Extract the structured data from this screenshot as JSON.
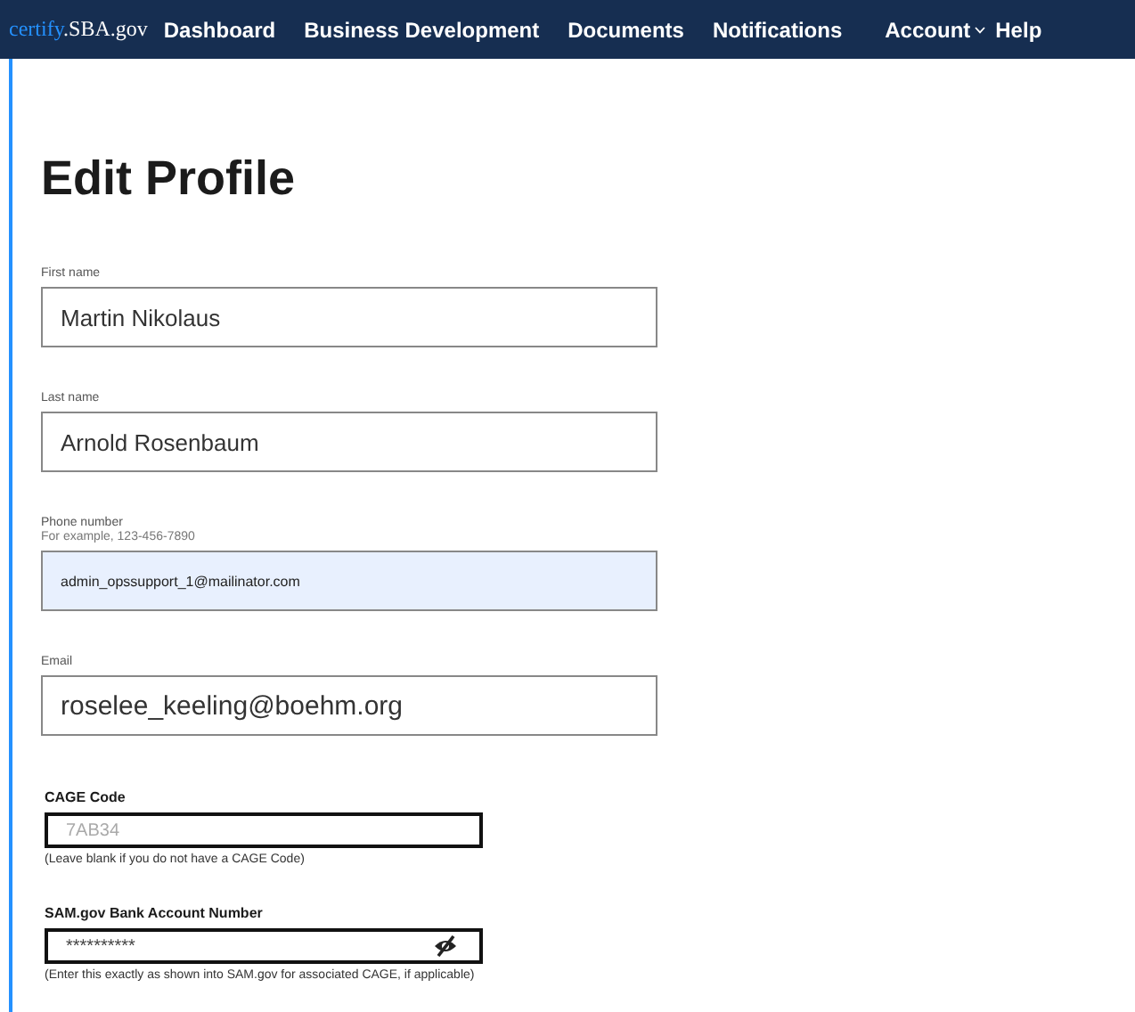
{
  "nav": {
    "logo": {
      "prefix": "certify",
      "suffix": ".SBA.gov"
    },
    "items": [
      {
        "label": "Dashboard",
        "kind": "link"
      },
      {
        "label": "Business Development",
        "kind": "link"
      },
      {
        "label": "Documents",
        "kind": "link"
      },
      {
        "label": "Notifications",
        "kind": "link"
      },
      {
        "label": "Account",
        "kind": "dropdown"
      },
      {
        "label": "Help",
        "kind": "link"
      }
    ]
  },
  "title": "Edit Profile",
  "fields": [
    {
      "kind": "text",
      "label": "First name",
      "value": "Martin Nikolaus"
    },
    {
      "kind": "text",
      "label": "Last name",
      "value": "Arnold Rosenbaum"
    },
    {
      "kind": "autofilled",
      "label": "Phone number",
      "hint": "For example, 123-456-7890",
      "value": "admin_opssupport_1@mailinator.com"
    },
    {
      "kind": "text",
      "label": "Email",
      "value": "roselee_keeling@boehm.org"
    },
    {
      "kind": "boxed",
      "label": "CAGE Code",
      "placeholder": "7AB34",
      "note": "(Leave blank if you do not have a CAGE Code)"
    },
    {
      "kind": "secret",
      "label": "SAM.gov Bank Account Number",
      "value": "**********",
      "note": "(Enter this exactly as shown into SAM.gov for associated CAGE, if applicable)"
    }
  ]
}
